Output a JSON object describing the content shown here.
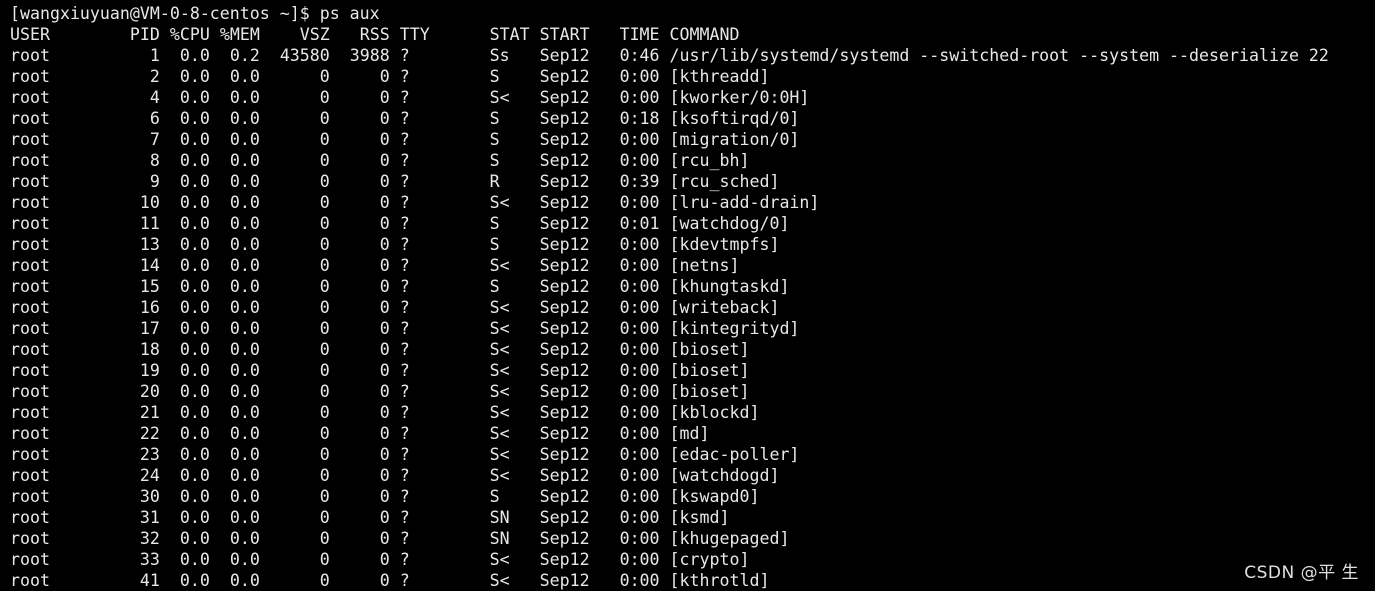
{
  "prompt": "[wangxiuyuan@VM-0-8-centos ~]$ ps aux",
  "header": {
    "user": "USER",
    "pid": "PID",
    "cpu": "%CPU",
    "mem": "%MEM",
    "vsz": "VSZ",
    "rss": "RSS",
    "tty": "TTY",
    "stat": "STAT",
    "start": "START",
    "time": "TIME",
    "command": "COMMAND"
  },
  "processes": [
    {
      "user": "root",
      "pid": "1",
      "cpu": "0.0",
      "mem": "0.2",
      "vsz": "43580",
      "rss": "3988",
      "tty": "?",
      "stat": "Ss",
      "start": "Sep12",
      "time": "0:46",
      "command": "/usr/lib/systemd/systemd --switched-root --system --deserialize 22"
    },
    {
      "user": "root",
      "pid": "2",
      "cpu": "0.0",
      "mem": "0.0",
      "vsz": "0",
      "rss": "0",
      "tty": "?",
      "stat": "S",
      "start": "Sep12",
      "time": "0:00",
      "command": "[kthreadd]"
    },
    {
      "user": "root",
      "pid": "4",
      "cpu": "0.0",
      "mem": "0.0",
      "vsz": "0",
      "rss": "0",
      "tty": "?",
      "stat": "S<",
      "start": "Sep12",
      "time": "0:00",
      "command": "[kworker/0:0H]"
    },
    {
      "user": "root",
      "pid": "6",
      "cpu": "0.0",
      "mem": "0.0",
      "vsz": "0",
      "rss": "0",
      "tty": "?",
      "stat": "S",
      "start": "Sep12",
      "time": "0:18",
      "command": "[ksoftirqd/0]"
    },
    {
      "user": "root",
      "pid": "7",
      "cpu": "0.0",
      "mem": "0.0",
      "vsz": "0",
      "rss": "0",
      "tty": "?",
      "stat": "S",
      "start": "Sep12",
      "time": "0:00",
      "command": "[migration/0]"
    },
    {
      "user": "root",
      "pid": "8",
      "cpu": "0.0",
      "mem": "0.0",
      "vsz": "0",
      "rss": "0",
      "tty": "?",
      "stat": "S",
      "start": "Sep12",
      "time": "0:00",
      "command": "[rcu_bh]"
    },
    {
      "user": "root",
      "pid": "9",
      "cpu": "0.0",
      "mem": "0.0",
      "vsz": "0",
      "rss": "0",
      "tty": "?",
      "stat": "R",
      "start": "Sep12",
      "time": "0:39",
      "command": "[rcu_sched]"
    },
    {
      "user": "root",
      "pid": "10",
      "cpu": "0.0",
      "mem": "0.0",
      "vsz": "0",
      "rss": "0",
      "tty": "?",
      "stat": "S<",
      "start": "Sep12",
      "time": "0:00",
      "command": "[lru-add-drain]"
    },
    {
      "user": "root",
      "pid": "11",
      "cpu": "0.0",
      "mem": "0.0",
      "vsz": "0",
      "rss": "0",
      "tty": "?",
      "stat": "S",
      "start": "Sep12",
      "time": "0:01",
      "command": "[watchdog/0]"
    },
    {
      "user": "root",
      "pid": "13",
      "cpu": "0.0",
      "mem": "0.0",
      "vsz": "0",
      "rss": "0",
      "tty": "?",
      "stat": "S",
      "start": "Sep12",
      "time": "0:00",
      "command": "[kdevtmpfs]"
    },
    {
      "user": "root",
      "pid": "14",
      "cpu": "0.0",
      "mem": "0.0",
      "vsz": "0",
      "rss": "0",
      "tty": "?",
      "stat": "S<",
      "start": "Sep12",
      "time": "0:00",
      "command": "[netns]"
    },
    {
      "user": "root",
      "pid": "15",
      "cpu": "0.0",
      "mem": "0.0",
      "vsz": "0",
      "rss": "0",
      "tty": "?",
      "stat": "S",
      "start": "Sep12",
      "time": "0:00",
      "command": "[khungtaskd]"
    },
    {
      "user": "root",
      "pid": "16",
      "cpu": "0.0",
      "mem": "0.0",
      "vsz": "0",
      "rss": "0",
      "tty": "?",
      "stat": "S<",
      "start": "Sep12",
      "time": "0:00",
      "command": "[writeback]"
    },
    {
      "user": "root",
      "pid": "17",
      "cpu": "0.0",
      "mem": "0.0",
      "vsz": "0",
      "rss": "0",
      "tty": "?",
      "stat": "S<",
      "start": "Sep12",
      "time": "0:00",
      "command": "[kintegrityd]"
    },
    {
      "user": "root",
      "pid": "18",
      "cpu": "0.0",
      "mem": "0.0",
      "vsz": "0",
      "rss": "0",
      "tty": "?",
      "stat": "S<",
      "start": "Sep12",
      "time": "0:00",
      "command": "[bioset]"
    },
    {
      "user": "root",
      "pid": "19",
      "cpu": "0.0",
      "mem": "0.0",
      "vsz": "0",
      "rss": "0",
      "tty": "?",
      "stat": "S<",
      "start": "Sep12",
      "time": "0:00",
      "command": "[bioset]"
    },
    {
      "user": "root",
      "pid": "20",
      "cpu": "0.0",
      "mem": "0.0",
      "vsz": "0",
      "rss": "0",
      "tty": "?",
      "stat": "S<",
      "start": "Sep12",
      "time": "0:00",
      "command": "[bioset]"
    },
    {
      "user": "root",
      "pid": "21",
      "cpu": "0.0",
      "mem": "0.0",
      "vsz": "0",
      "rss": "0",
      "tty": "?",
      "stat": "S<",
      "start": "Sep12",
      "time": "0:00",
      "command": "[kblockd]"
    },
    {
      "user": "root",
      "pid": "22",
      "cpu": "0.0",
      "mem": "0.0",
      "vsz": "0",
      "rss": "0",
      "tty": "?",
      "stat": "S<",
      "start": "Sep12",
      "time": "0:00",
      "command": "[md]"
    },
    {
      "user": "root",
      "pid": "23",
      "cpu": "0.0",
      "mem": "0.0",
      "vsz": "0",
      "rss": "0",
      "tty": "?",
      "stat": "S<",
      "start": "Sep12",
      "time": "0:00",
      "command": "[edac-poller]"
    },
    {
      "user": "root",
      "pid": "24",
      "cpu": "0.0",
      "mem": "0.0",
      "vsz": "0",
      "rss": "0",
      "tty": "?",
      "stat": "S<",
      "start": "Sep12",
      "time": "0:00",
      "command": "[watchdogd]"
    },
    {
      "user": "root",
      "pid": "30",
      "cpu": "0.0",
      "mem": "0.0",
      "vsz": "0",
      "rss": "0",
      "tty": "?",
      "stat": "S",
      "start": "Sep12",
      "time": "0:00",
      "command": "[kswapd0]"
    },
    {
      "user": "root",
      "pid": "31",
      "cpu": "0.0",
      "mem": "0.0",
      "vsz": "0",
      "rss": "0",
      "tty": "?",
      "stat": "SN",
      "start": "Sep12",
      "time": "0:00",
      "command": "[ksmd]"
    },
    {
      "user": "root",
      "pid": "32",
      "cpu": "0.0",
      "mem": "0.0",
      "vsz": "0",
      "rss": "0",
      "tty": "?",
      "stat": "SN",
      "start": "Sep12",
      "time": "0:00",
      "command": "[khugepaged]"
    },
    {
      "user": "root",
      "pid": "33",
      "cpu": "0.0",
      "mem": "0.0",
      "vsz": "0",
      "rss": "0",
      "tty": "?",
      "stat": "S<",
      "start": "Sep12",
      "time": "0:00",
      "command": "[crypto]"
    },
    {
      "user": "root",
      "pid": "41",
      "cpu": "0.0",
      "mem": "0.0",
      "vsz": "0",
      "rss": "0",
      "tty": "?",
      "stat": "S<",
      "start": "Sep12",
      "time": "0:00",
      "command": "[kthrotld]"
    }
  ],
  "watermark": "CSDN @平 生",
  "colors": {
    "background": "#000000",
    "text": "#e8e8e8"
  }
}
